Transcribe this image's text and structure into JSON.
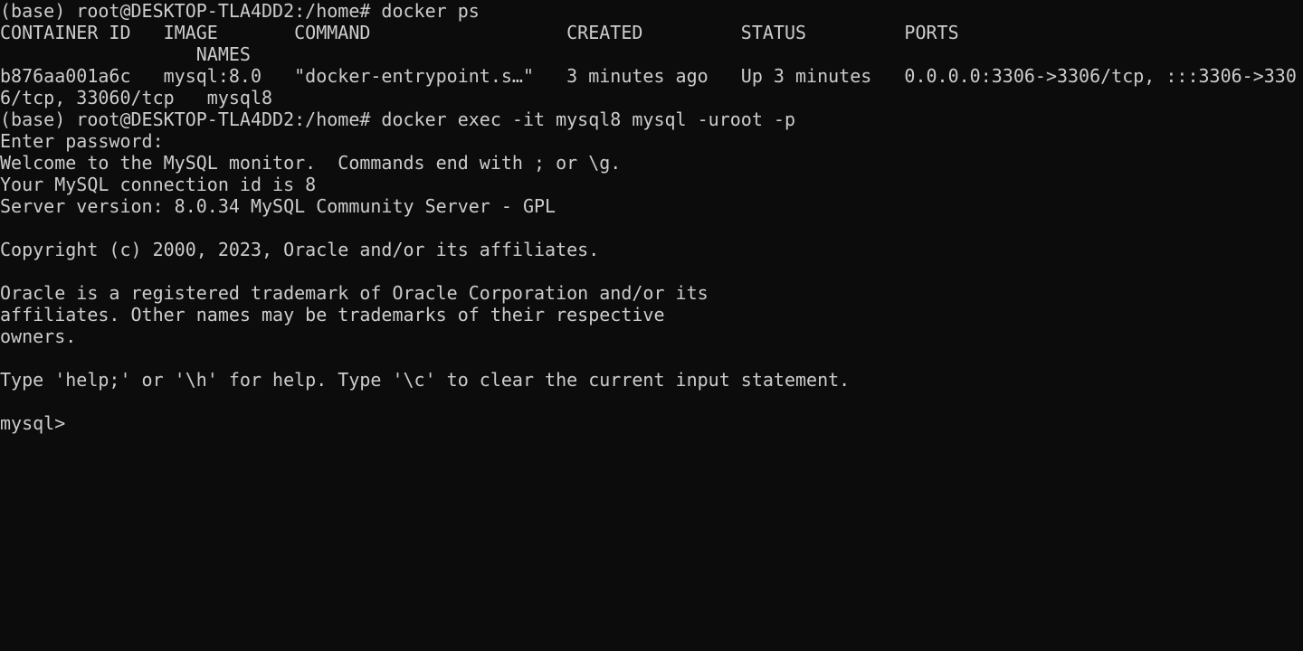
{
  "terminal": {
    "background": "#0c0c0c",
    "foreground": "#cccccc",
    "lines": [
      "(base) root@DESKTOP-TLA4DD2:/home# docker ps",
      "CONTAINER ID   IMAGE       COMMAND                  CREATED         STATUS         PORTS",
      "                  NAMES",
      "b876aa001a6c   mysql:8.0   \"docker-entrypoint.s…\"   3 minutes ago   Up 3 minutes   0.0.0.0:3306->3306/tcp, :::3306->330",
      "6/tcp, 33060/tcp   mysql8",
      "(base) root@DESKTOP-TLA4DD2:/home# docker exec -it mysql8 mysql -uroot -p",
      "Enter password:",
      "Welcome to the MySQL monitor.  Commands end with ; or \\g.",
      "Your MySQL connection id is 8",
      "Server version: 8.0.34 MySQL Community Server - GPL",
      "",
      "Copyright (c) 2000, 2023, Oracle and/or its affiliates.",
      "",
      "Oracle is a registered trademark of Oracle Corporation and/or its",
      "affiliates. Other names may be trademarks of their respective",
      "owners.",
      "",
      "Type 'help;' or '\\h' for help. Type '\\c' to clear the current input statement.",
      "",
      "mysql>"
    ]
  }
}
